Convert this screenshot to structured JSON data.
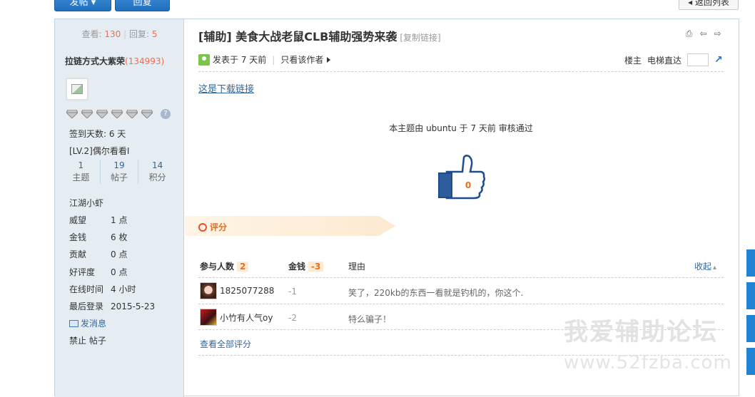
{
  "top": {
    "post_button": "发帖",
    "reply_button": "回复",
    "back_button": "返回列表"
  },
  "sidebar": {
    "views_label": "查看:",
    "views": "130",
    "replies_label": "回复:",
    "replies": "5",
    "author_name": "拉链方式大紫荣",
    "author_uid": "(134993)",
    "signin_days": "签到天数: 6 天",
    "level": "[LV.2]偶尔看看I",
    "counts": [
      {
        "value": "1",
        "label": "主题"
      },
      {
        "value": "19",
        "label": "帖子"
      },
      {
        "value": "14",
        "label": "积分"
      }
    ],
    "rank": "江湖小虾",
    "stats": [
      {
        "key": "威望",
        "val": "1 点"
      },
      {
        "key": "金钱",
        "val": "6 枚"
      },
      {
        "key": "贡献",
        "val": "0 点"
      },
      {
        "key": "好评度",
        "val": "0 点"
      },
      {
        "key": "在线时间",
        "val": "4 小时"
      },
      {
        "key": "最后登录",
        "val": "2015-5-23"
      }
    ],
    "send_message": "发消息",
    "ban_posts": "禁止 帖子"
  },
  "post": {
    "title": "[辅助] 美食大战老鼠CLB辅助强势来袭",
    "copy_link": "[复制链接]",
    "posted_at": "发表于 7 天前",
    "only_author": "只看该作者",
    "floor_label": "楼主",
    "jump_label": "电梯直达",
    "download_link": "这是下载链接",
    "audit_note": "本主题由 ubuntu 于 7 天前 审核通过",
    "like_count": "0"
  },
  "rating": {
    "section_label": "评分",
    "participants_label": "参与人数",
    "participants_count": "2",
    "money_label": "金钱",
    "money_total": "-3",
    "reason_label": "理由",
    "collapse_label": "收起",
    "rows": [
      {
        "user": "1825077288",
        "money": "-1",
        "reason": "笑了，220kb的东西一看就是钓机的，你这个."
      },
      {
        "user": "小竹有人气oy",
        "money": "-2",
        "reason": "特么骗子！"
      }
    ],
    "view_all": "查看全部评分"
  },
  "watermark": {
    "text": "我爱辅助论坛",
    "url": "www.52fzba.com"
  }
}
